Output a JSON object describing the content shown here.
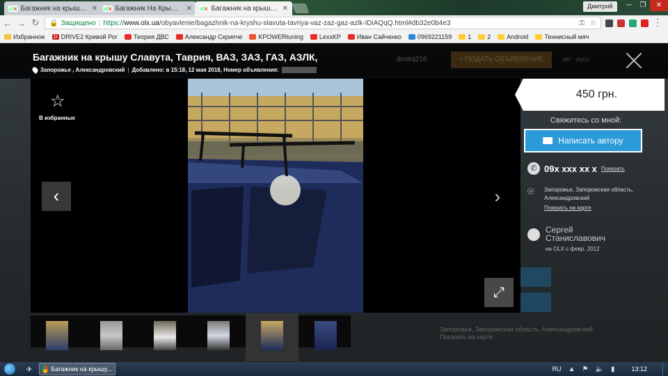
{
  "browser": {
    "tabs": [
      {
        "favicon": "olx",
        "title": "Багажник на крышу Ла"
      },
      {
        "favicon": "olx",
        "title": "Багажник На Крышу Та"
      },
      {
        "favicon": "olx",
        "title": "Багажник на крышу Сла",
        "active": true
      }
    ],
    "profile_name": "Дмитрий",
    "address": {
      "security_label": "Защищено",
      "url_scheme": "https://",
      "url_host": "www.olx.ua",
      "url_path": "/obyavlenie/bagazhnik-na-kryshu-slavuta-tavriya-vaz-zaz-gaz-azlk-IDiAQqQ.html#db32e0b4e3"
    },
    "bookmarks": [
      {
        "icon": "apps-icon",
        "label": "Избранное"
      },
      {
        "icon": "d-icon",
        "label": "DRIVE2 Кривой Рог"
      },
      {
        "icon": "youtube-icon",
        "label": "Теория ДВС"
      },
      {
        "icon": "youtube-icon",
        "label": "Александр Скрипче"
      },
      {
        "icon": "stop-icon",
        "label": "KPOWERtuning"
      },
      {
        "icon": "youtube-icon",
        "label": "LexxKP"
      },
      {
        "icon": "youtube-icon",
        "label": "Иван Сайченко"
      },
      {
        "icon": "calc-icon",
        "label": "0969221159"
      },
      {
        "icon": "beeline-icon",
        "label": "1"
      },
      {
        "icon": "beeline-icon",
        "label": "2"
      },
      {
        "icon": "beeline-icon",
        "label": "Android"
      },
      {
        "icon": "beeline-icon",
        "label": "Теннисный мяч"
      }
    ]
  },
  "ad": {
    "title": "Багажник на крышу Славута, Таврия, ВАЗ, ЗАЗ, ГАЗ, АЗЛК,",
    "location": "Запорожье , Александровский",
    "added": "Добавлено: в 15:18, 12 мая 2018, Номер объявления:",
    "favorite_label": "В избранные",
    "price": "450 грн.",
    "contact_header": "Свяжитесь со мной:",
    "write_button": "Написать автору",
    "phone": "09x xxx xx x",
    "show_phone": "Показать",
    "seller_location": "Запорожье, Запорожская область, Александровский",
    "show_on_map": "Показать на карте",
    "seller_name": "Сергей Станиславович",
    "seller_since": "на OLX с февр. 2012",
    "background_user": "dmitrij216",
    "background_post_button": "+ ПОДАТЬ ОБЪЯВЛЕНИЕ",
    "background_lang": "ukr · русс",
    "background_location": "Запорожье, Запорожская область, Александровский",
    "background_map": "Показать на карте"
  },
  "gallery": {
    "thumbnail_count": 6,
    "selected_index": 4
  },
  "taskbar": {
    "task_label": "Багажник на крышу...",
    "language": "RU",
    "time": "13:12"
  }
}
